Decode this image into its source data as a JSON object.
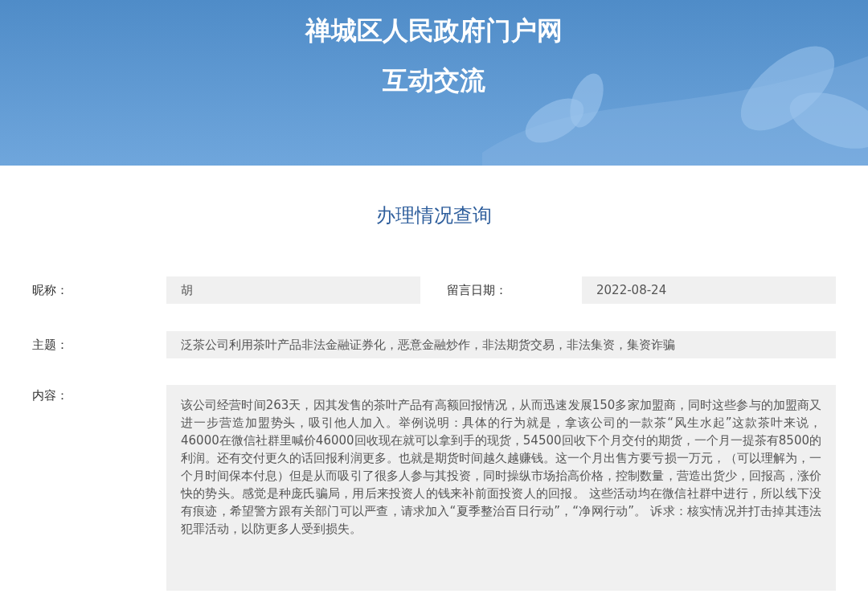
{
  "banner": {
    "title": "禅城区人民政府门户网",
    "subtitle": "互动交流"
  },
  "section_title": "办理情况查询",
  "fields": [
    {
      "label": "昵称：",
      "value": "胡"
    },
    {
      "label": "留言日期：",
      "value": "2022-08-24"
    },
    {
      "label": "主题：",
      "value": "泛茶公司利用茶叶产品非法金融证券化，恶意金融炒作，非法期货交易，非法集资，集资诈骗"
    },
    {
      "label": "内容：",
      "value": "该公司经营时间263天，因其发售的茶叶产品有高额回报情况，从而迅速发展150多家加盟商，同时这些参与的加盟商又进一步营造加盟势头，吸引他人加入。举例说明：具体的行为就是，拿该公司的一款茶“风生水起”这款茶叶来说，46000在微信社群里喊价46000回收现在就可以拿到手的现货，54500回收下个月交付的期货，一个月一提茶有8500的利润。还有交付更久的话回报利润更多。也就是期货时间越久越赚钱。这一个月出售方要亏损一万元，（可以理解为，一个月时间保本付息）但是从而吸引了很多人参与其投资，同时操纵市场抬高价格，控制数量，营造出货少，回报高，涨价快的势头。感觉是种庞氏骗局，用后来投资人的钱来补前面投资人的回报。 这些活动均在微信社群中进行，所以线下没有痕迹，希望警方跟有关部门可以严查，请求加入“夏季整治百日行动”，“净网行动”。 诉求：核实情况并打击掉其违法犯罪活动，以防更多人受到损失。"
    }
  ]
}
